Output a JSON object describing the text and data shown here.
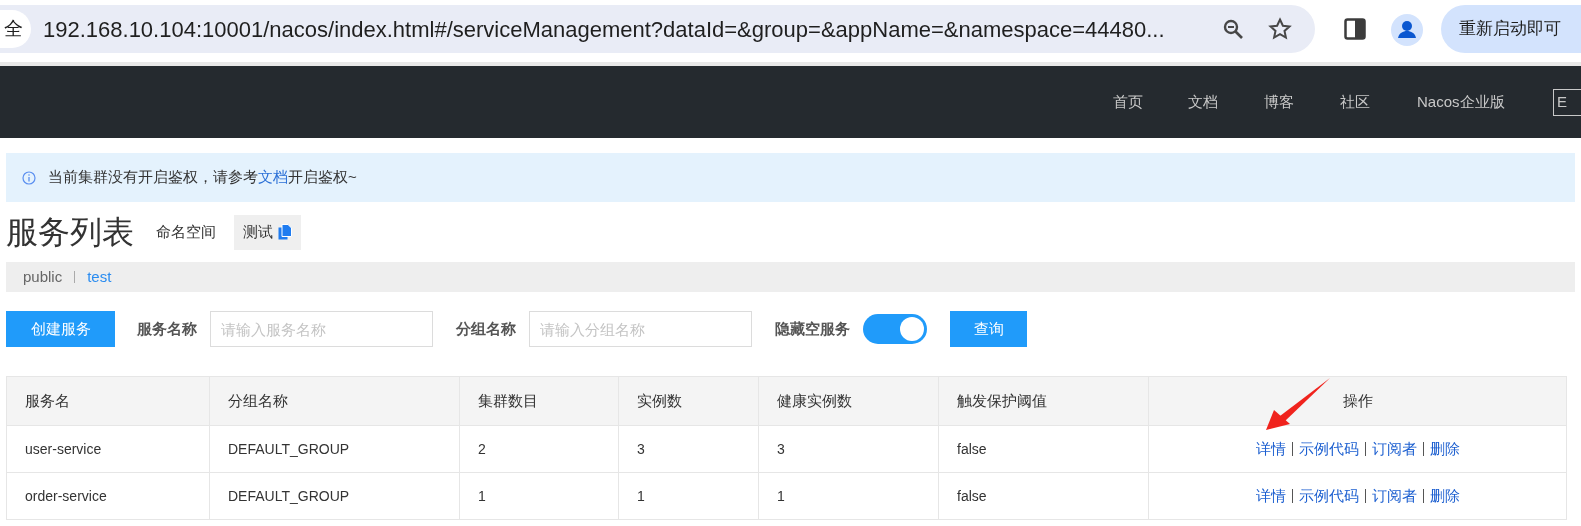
{
  "browser": {
    "security_chip": "全",
    "url": "192.168.10.104:10001/nacos/index.html#/serviceManagement?dataId=&group=&appName=&namespace=44480...",
    "restart_button": "重新启动即可"
  },
  "nav": {
    "items": [
      "首页",
      "文档",
      "博客",
      "社区",
      "Nacos企业版"
    ],
    "language_button": "E"
  },
  "alert": {
    "before": "当前集群没有开启鉴权，请参考",
    "link": "文档",
    "after": "开启鉴权~"
  },
  "page": {
    "title": "服务列表",
    "namespace_label": "命名空间",
    "namespace_value": "测试"
  },
  "namespaces": [
    {
      "label": "public",
      "selected": false
    },
    {
      "label": "test",
      "selected": true
    }
  ],
  "form": {
    "create_button": "创建服务",
    "service_label": "服务名称",
    "service_placeholder": "请输入服务名称",
    "group_label": "分组名称",
    "group_placeholder": "请输入分组名称",
    "hide_empty_label": "隐藏空服务",
    "hide_empty_on": true,
    "query_button": "查询"
  },
  "table": {
    "columns": [
      "服务名",
      "分组名称",
      "集群数目",
      "实例数",
      "健康实例数",
      "触发保护阈值",
      "操作"
    ],
    "rows": [
      {
        "cells": [
          "user-service",
          "DEFAULT_GROUP",
          "2",
          "3",
          "3",
          "false"
        ],
        "actions": [
          "详情",
          "示例代码",
          "订阅者",
          "删除"
        ]
      },
      {
        "cells": [
          "order-service",
          "DEFAULT_GROUP",
          "1",
          "1",
          "1",
          "false"
        ],
        "actions": [
          "详情",
          "示例代码",
          "订阅者",
          "删除"
        ]
      }
    ]
  }
}
